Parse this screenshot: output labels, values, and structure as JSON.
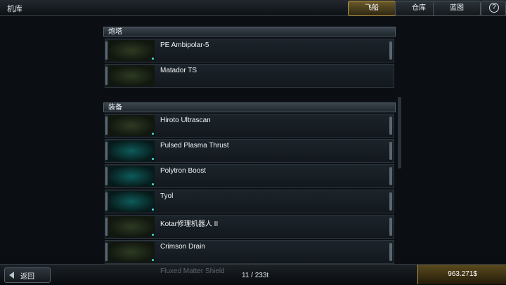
{
  "topbar": {
    "title": "机库",
    "tabs": [
      {
        "label": "飞船",
        "active": true
      },
      {
        "label": "仓库",
        "active": false
      },
      {
        "label": "蓝图",
        "active": false
      }
    ],
    "help_icon": "help-icon"
  },
  "sections": [
    {
      "header": "炮塔",
      "items": [
        {
          "name": "PE Ambipolar-5"
        },
        {
          "name": "Matador TS"
        }
      ]
    },
    {
      "header": "装备",
      "items": [
        {
          "name": "Hiroto Ultrascan"
        },
        {
          "name": "Pulsed Plasma Thrust"
        },
        {
          "name": "Polytron Boost"
        },
        {
          "name": "Tyol"
        },
        {
          "name": "Kotar修理机器人 II"
        },
        {
          "name": "Crimson Drain"
        },
        {
          "name": "Fluxed Matter Shield"
        }
      ]
    }
  ],
  "footer": {
    "back_label": "返回",
    "count": "11 / 233t",
    "money": "963.271$"
  },
  "colors": {
    "accent": "#b79a4a",
    "item_dot": "#3fe0e0"
  }
}
